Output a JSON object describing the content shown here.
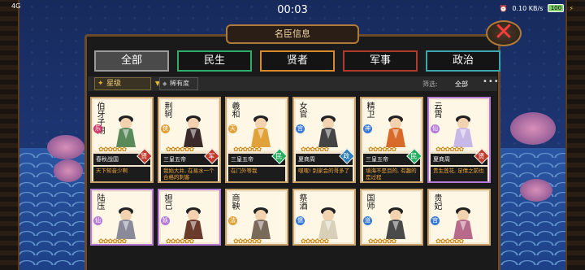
{
  "status_bar": {
    "signal": "4G",
    "time": "00:03",
    "speed": "0.10\nKB/s",
    "battery": "100"
  },
  "header": {
    "title": "名臣信息",
    "close_icon": "close-icon"
  },
  "tabs": [
    {
      "label": "全部",
      "active": true
    },
    {
      "label": "民生",
      "active": false
    },
    {
      "label": "贤者",
      "active": false
    },
    {
      "label": "军事",
      "active": false
    },
    {
      "label": "政治",
      "active": false
    }
  ],
  "filter_bar": {
    "sort_label": "星级",
    "rarity_label": "稀有度",
    "filter_label": "筛选:",
    "filter_value": "全部",
    "more_icon": "ellipsis-icon"
  },
  "cards_row1": [
    {
      "name": "伯牙子期",
      "badge": "乐",
      "badge_color": "#d23a6a",
      "era": "春秋战国",
      "type": "贤",
      "type_color": "#c0392b",
      "quote": "天下知音少啊",
      "frame": "gold"
    },
    {
      "name": "荆轲",
      "badge": "侠",
      "badge_color": "#e2a23a",
      "era": "三皇五帝",
      "type": "军",
      "type_color": "#c0392b",
      "quote": "我始大井, 在易水一个合格的刺客",
      "frame": "gold"
    },
    {
      "name": "羲和",
      "badge": "天",
      "badge_color": "#e2a23a",
      "era": "三皇五帝",
      "type": "民",
      "type_color": "#27ae60",
      "quote": "在门外等我",
      "frame": "gold"
    },
    {
      "name": "女官",
      "badge": "宫",
      "badge_color": "#3a7ad6",
      "era": "夏商周",
      "type": "政",
      "type_color": "#2c7fb8",
      "quote": "嘿嘿! 别家会的哥多了",
      "frame": "gold"
    },
    {
      "name": "精卫",
      "badge": "神",
      "badge_color": "#3a7ad6",
      "era": "三皇五帝",
      "type": "民",
      "type_color": "#27ae60",
      "quote": "填海不是目的, 有趣的是过程",
      "frame": "gold"
    },
    {
      "name": "云霄",
      "badge": "仙",
      "badge_color": "#b47ad6",
      "era": "夏商周",
      "type": "贤",
      "type_color": "#c0392b",
      "quote": "贵生莲花, 足倩之前也",
      "frame": "purple"
    }
  ],
  "cards_row2": [
    {
      "name": "陆压",
      "badge": "仙",
      "badge_color": "#b47ad6",
      "frame": "purple"
    },
    {
      "name": "妲己",
      "badge": "妖",
      "badge_color": "#b47ad6",
      "frame": "purple"
    },
    {
      "name": "商鞅",
      "badge": "法",
      "badge_color": "#e2a23a",
      "frame": "gold"
    },
    {
      "name": "祭酒",
      "badge": "儒",
      "badge_color": "#3a7ad6",
      "frame": "gold"
    },
    {
      "name": "国师",
      "badge": "道",
      "badge_color": "#3a7ad6",
      "frame": "gold"
    },
    {
      "name": "贵妃",
      "badge": "宫",
      "badge_color": "#3a7ad6",
      "frame": "gold"
    }
  ],
  "stars_glyph": "✿✿✿✿✿✿"
}
